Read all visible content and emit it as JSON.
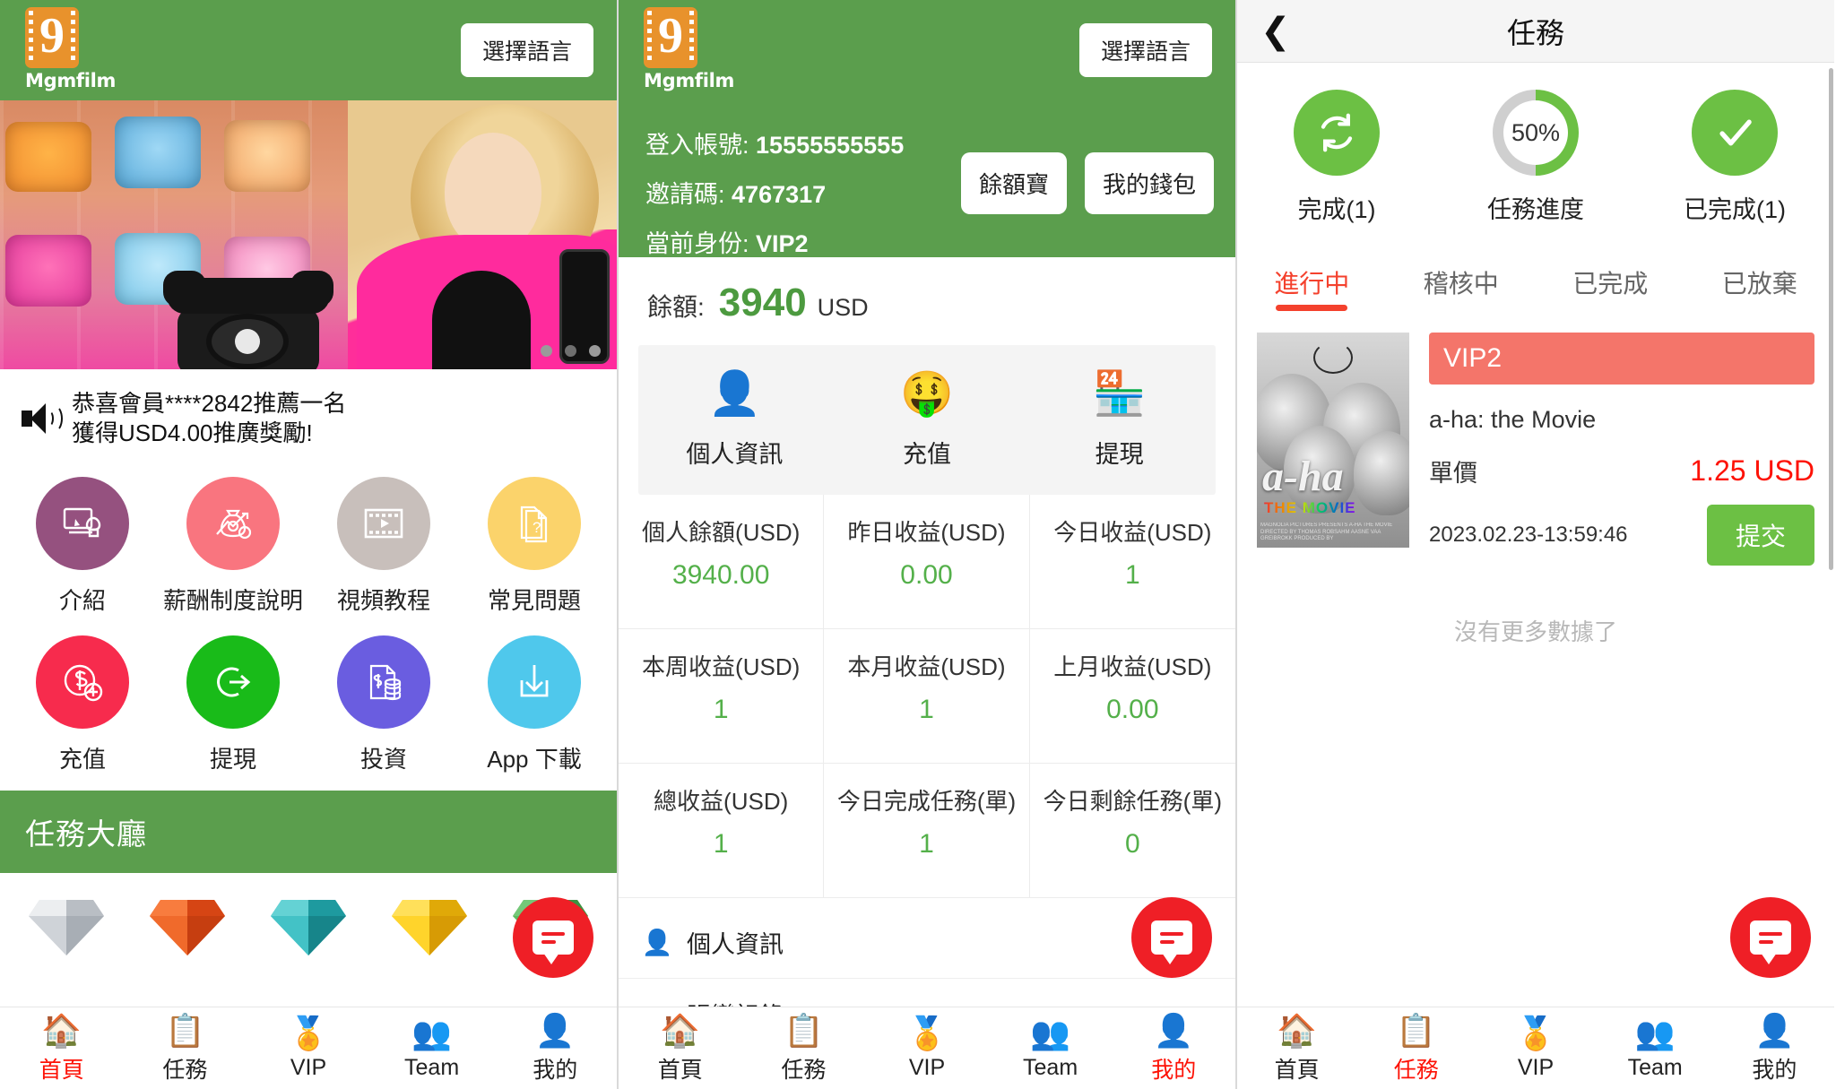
{
  "brand": {
    "name": "Mgmfilm",
    "logo_glyph": "9"
  },
  "common": {
    "lang_button": "選擇語言"
  },
  "panel_home": {
    "notice": "恭喜會員****2842推薦一名獲得USD4.00推廣獎勵!",
    "notice_line1": "恭喜會員****2842推薦一名",
    "notice_line2": "獲得USD4.00推廣獎勵!",
    "shortcuts": [
      {
        "label": "介紹",
        "color": "#95517f",
        "icon": "monitor-plant-icon"
      },
      {
        "label": "薪酬制度說明",
        "color": "#f9757f",
        "icon": "money-bag-growth-icon"
      },
      {
        "label": "視頻教程",
        "color": "#c8bfbb",
        "icon": "video-film-icon"
      },
      {
        "label": "常見問題",
        "color": "#fbd36b",
        "icon": "faq-document-icon"
      },
      {
        "label": "充值",
        "color": "#f72b4d",
        "icon": "dollar-plus-icon"
      },
      {
        "label": "提現",
        "color": "#19bb19",
        "icon": "withdraw-arrow-icon"
      },
      {
        "label": "投資",
        "color": "#6a5de0",
        "icon": "invest-coins-icon"
      },
      {
        "label": "App 下載",
        "color": "#4fc8ec",
        "icon": "download-icon"
      }
    ],
    "task_hall_title": "任務大廳",
    "gems": [
      {
        "name": "silver-diamond",
        "color": "#c9cdd2"
      },
      {
        "name": "orange-diamond",
        "color": "#ef5a20"
      },
      {
        "name": "teal-diamond",
        "color": "#2fb8bd"
      },
      {
        "name": "gold-diamond",
        "color": "#f9c816"
      },
      {
        "name": "green-diamond",
        "color": "#4caf50"
      }
    ]
  },
  "panel_account": {
    "account_label": "登入帳號:",
    "account_value": "15555555555",
    "invite_label": "邀請碼:",
    "invite_value": "4767317",
    "identity_label": "當前身份:",
    "identity_value": "VIP2",
    "buttons": {
      "yuebao": "餘額寶",
      "wallet": "我的錢包"
    },
    "balance_label": "餘額:",
    "balance_amount": "3940",
    "balance_currency": "USD",
    "quick_actions": [
      {
        "label": "個人資訊",
        "emoji": "👤",
        "icon": "person-icon"
      },
      {
        "label": "充值",
        "emoji": "🤑",
        "icon": "money-hand-icon"
      },
      {
        "label": "提現",
        "emoji": "🏪",
        "icon": "cash-register-icon"
      }
    ],
    "stats": [
      {
        "label": "個人餘額(USD)",
        "value": "3940.00"
      },
      {
        "label": "昨日收益(USD)",
        "value": "0.00"
      },
      {
        "label": "今日收益(USD)",
        "value": "1"
      },
      {
        "label": "本周收益(USD)",
        "value": "1"
      },
      {
        "label": "本月收益(USD)",
        "value": "1"
      },
      {
        "label": "上月收益(USD)",
        "value": "0.00"
      },
      {
        "label": "總收益(USD)",
        "value": "1"
      },
      {
        "label": "今日完成任務(單)",
        "value": "1"
      },
      {
        "label": "今日剩餘任務(單)",
        "value": "0"
      }
    ],
    "menu": [
      {
        "label": "個人資訊",
        "icon": "person-edit-icon",
        "emoji": "👤"
      },
      {
        "label": "賬變記錄",
        "icon": "percent-tag-icon",
        "emoji": "％"
      }
    ]
  },
  "panel_task": {
    "title": "任務",
    "back_icon": "back-chevron-icon",
    "progress": [
      {
        "label": "完成(1)",
        "icon": "refresh-circle-icon",
        "type": "solid"
      },
      {
        "label": "任務進度",
        "icon": "progress-ring-icon",
        "type": "ring",
        "percent": "50%",
        "percent_value": 50
      },
      {
        "label": "已完成(1)",
        "icon": "check-circle-icon",
        "type": "solid"
      }
    ],
    "tabs": [
      {
        "label": "進行中",
        "active": true
      },
      {
        "label": "稽核中",
        "active": false
      },
      {
        "label": "已完成",
        "active": false
      },
      {
        "label": "已放棄",
        "active": false
      }
    ],
    "card": {
      "badge": "VIP2",
      "movie_title": "a-ha: the Movie",
      "poster_title": "a-ha",
      "poster_subtitle": "THE MOVIE",
      "price_label": "單價",
      "price_value": "1.25 USD",
      "datetime": "2023.02.23-13:59:46",
      "submit_label": "提交"
    },
    "empty_text": "沒有更多數據了"
  },
  "bottom_nav": [
    {
      "label": "首頁",
      "emoji": "🏠",
      "icon": "home-icon"
    },
    {
      "label": "任務",
      "emoji": "📋",
      "icon": "clipboard-icon"
    },
    {
      "label": "VIP",
      "emoji": "🏅",
      "icon": "vip-wreath-icon"
    },
    {
      "label": "Team",
      "emoji": "👥",
      "icon": "team-icon"
    },
    {
      "label": "我的",
      "emoji": "👤",
      "icon": "profile-icon"
    }
  ],
  "active_nav": {
    "panel1": 0,
    "panel2": 4,
    "panel3": 1
  },
  "fab": {
    "icon": "chat-bubble-icon"
  },
  "colors": {
    "brand_green": "#5b9e4d",
    "accent_green": "#6cc044",
    "accent_red": "#fd1206",
    "badge_salmon": "#f4756a",
    "logo_orange": "#e8922c"
  }
}
